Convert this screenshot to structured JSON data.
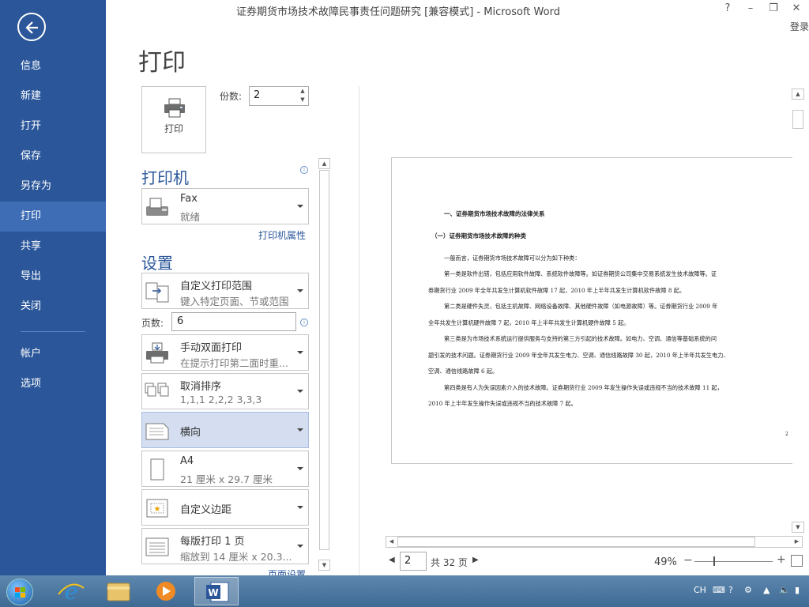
{
  "window": {
    "title": "证券期货市场技术故障民事责任问题研究 [兼容模式] - Microsoft Word",
    "help": "?",
    "minimize": "–",
    "restore": "❐",
    "close": "✕",
    "login": "登录"
  },
  "sidebar": {
    "items": [
      {
        "label": "信息"
      },
      {
        "label": "新建"
      },
      {
        "label": "打开"
      },
      {
        "label": "保存"
      },
      {
        "label": "另存为"
      },
      {
        "label": "打印"
      },
      {
        "label": "共享"
      },
      {
        "label": "导出"
      },
      {
        "label": "关闭"
      },
      {
        "label": "帐户"
      },
      {
        "label": "选项"
      }
    ],
    "active": "打印"
  },
  "print": {
    "heading": "打印",
    "button_label": "打印",
    "copies_label": "份数:",
    "copies_value": "2",
    "printer_section": "打印机",
    "printer_name": "Fax",
    "printer_status": "就绪",
    "printer_properties": "打印机属性",
    "settings_section": "设置",
    "range_title": "自定义打印范围",
    "range_desc": "键入特定页面、节或范围",
    "pages_label": "页数:",
    "pages_value": "6",
    "duplex_title": "手动双面打印",
    "duplex_desc": "在提示打印第二面时重...",
    "collate_title": "取消排序",
    "collate_desc": "1,1,1    2,2,2    3,3,3",
    "orientation": "横向",
    "paper_title": "A4",
    "paper_desc": "21 厘米 x 29.7 厘米",
    "margins": "自定义边距",
    "per_page_title": "每版打印 1 页",
    "per_page_desc": "缩放到 14 厘米 x 20.3...",
    "page_setup": "页面设置"
  },
  "preview": {
    "heading1": "一、证券期货市场技术故障的法律关系",
    "heading2": "（一）证券期货市场技术故障的种类",
    "lines": [
      "一般而言，证券期货市场技术故障可以分为如下种类：",
      "第一类是软件出错，包括应用软件故障、系统软件故障等。如证券期货公司集中交易系统发生技术故障等。证",
      "券期货行业 2009 年全年共发生计算机软件故障 17 起，2010 年上半年共发生计算机软件故障 8 起。",
      "第二类是硬件失灵，包括主机故障、网络设备故障、其他硬件故障（如电源故障）等。证券期货行业 2009 年",
      "全年共发生计算机硬件故障 7 起，2010 年上半年共发生计算机硬件故障 5 起。",
      "第三类是为市场技术系统运行提供服务与支持的第三方引起的技术故障。如电力、空调、通信等基础系统的问",
      "题引发的技术问题。证券期货行业 2009 年全年共发生电力、空调、通信线路故障 30 起，2010 年上半年共发生电力、",
      "空调、通信线路故障 6 起。",
      "第四类是有人为失误因素介入的技术故障。证券期货行业 2009 年发生操作失误或违规不当的技术故障 11 起，",
      "2010 年上半年发生操作失误或违规不当的技术故障 7 起。"
    ],
    "page_marker": "2"
  },
  "navigation": {
    "current_page": "2",
    "total": "共 32 页",
    "zoom": "49%",
    "zoom_fraction": 0.25
  },
  "taskbar": {
    "apps": [
      "start-icon",
      "ie-icon",
      "explorer-icon",
      "media-player-icon",
      "word-icon"
    ],
    "lang": "CH"
  },
  "colors": {
    "backstage": "#2b579a",
    "active_nav": "#3e6db5",
    "selected_option": "#d4def0"
  }
}
